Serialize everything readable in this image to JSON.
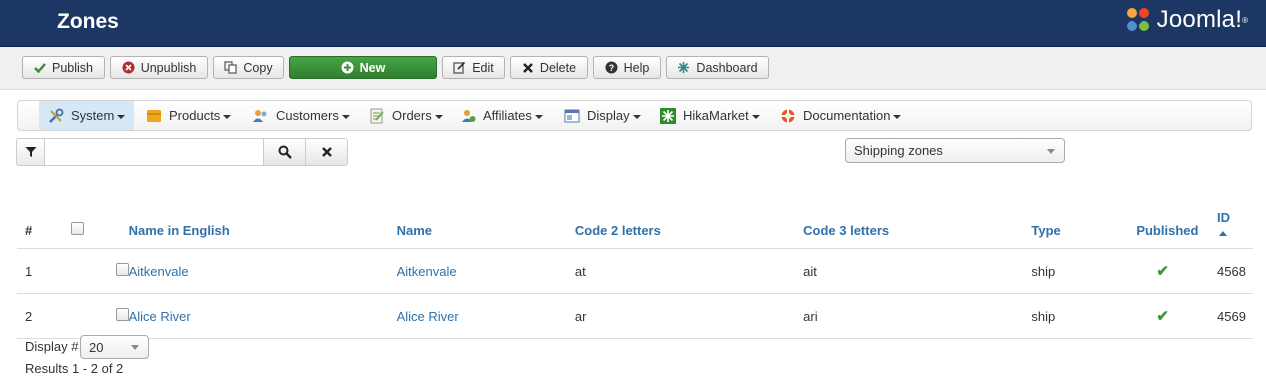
{
  "header": {
    "title": "Zones",
    "logo_text": "Joomla!"
  },
  "toolbar": {
    "publish": "Publish",
    "unpublish": "Unpublish",
    "copy": "Copy",
    "new": "New",
    "edit": "Edit",
    "delete": "Delete",
    "help": "Help",
    "dashboard": "Dashboard"
  },
  "menu": {
    "system": "System",
    "products": "Products",
    "customers": "Customers",
    "orders": "Orders",
    "affiliates": "Affiliates",
    "display": "Display",
    "hikamarket": "HikaMarket",
    "documentation": "Documentation"
  },
  "filter": {
    "search_value": "",
    "type_selected": "Shipping zones"
  },
  "table": {
    "columns": {
      "num": "#",
      "name_english": "Name in English",
      "name": "Name",
      "code2": "Code 2 letters",
      "code3": "Code 3 letters",
      "type": "Type",
      "published": "Published",
      "id": "ID"
    },
    "rows": [
      {
        "num": "1",
        "name_english": "Aitkenvale",
        "name": "Aitkenvale",
        "code2": "at",
        "code3": "ait",
        "type": "ship",
        "published": "✔",
        "id": "4568"
      },
      {
        "num": "2",
        "name_english": "Alice River",
        "name": "Alice River",
        "code2": "ar",
        "code3": "ari",
        "type": "ship",
        "published": "✔",
        "id": "4569"
      }
    ]
  },
  "footer": {
    "display_label": "Display #",
    "limit_value": "20",
    "results": "Results 1 - 2 of 2"
  },
  "colors": {
    "header_bg": "#1c3764",
    "new_button": "#3a913a",
    "link": "#3071a9",
    "published_tick": "#3a9a3a"
  }
}
